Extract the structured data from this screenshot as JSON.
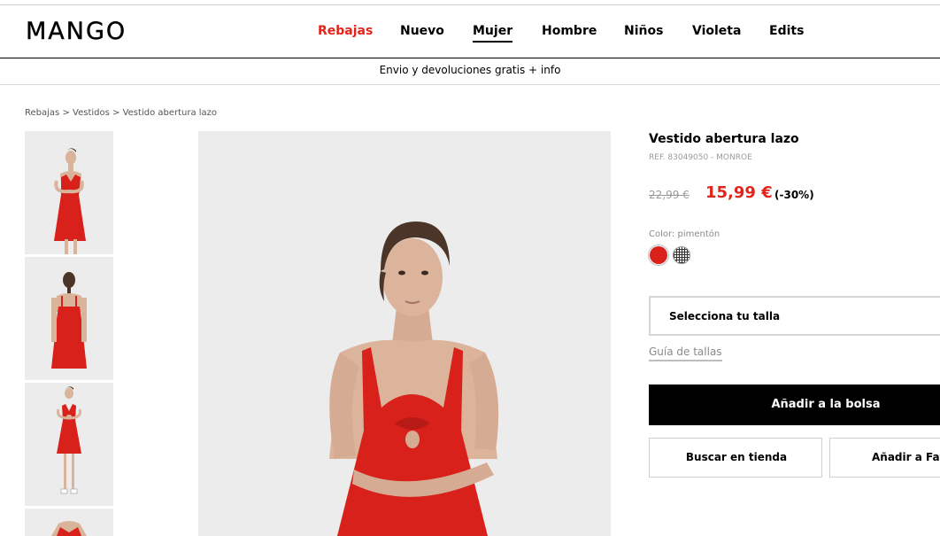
{
  "brand": "MANGO",
  "nav": {
    "items": [
      "Rebajas",
      "Nuevo",
      "Mujer",
      "Hombre",
      "Niños",
      "Violeta",
      "Edits"
    ]
  },
  "promo": {
    "text": "Envio y devoluciones gratis",
    "link": "+ info"
  },
  "breadcrumb": {
    "items": [
      "Rebajas",
      "Vestidos",
      "Vestido abertura lazo"
    ],
    "separator": ">"
  },
  "product": {
    "title": "Vestido abertura lazo",
    "ref": "REF. 83049050 - MONROE",
    "old_price": "22,99 €",
    "new_price": "15,99 €",
    "discount": "(-30%)",
    "color_label": "Color: pimentón",
    "swatches": [
      "red-swatch",
      "gingham-swatch"
    ],
    "size_select": "Selecciona tu talla",
    "size_guide": "Guía de tallas",
    "add_to_bag": "Añadir a la bolsa",
    "find_in_store": "Buscar en tienda",
    "add_to_favorites": "Añadir a Favo"
  },
  "colors": {
    "accent_sale": "#e2241b",
    "dress_red": "#d8211b",
    "button_black": "#000000"
  }
}
